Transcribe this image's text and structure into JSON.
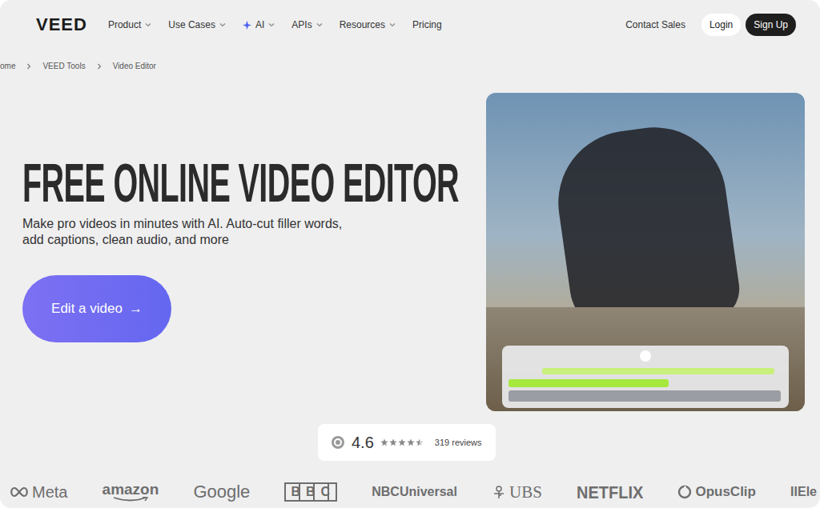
{
  "logo": "VEED",
  "nav": {
    "items": [
      {
        "label": "Product",
        "dropdown": true,
        "kind": "plain"
      },
      {
        "label": "Use Cases",
        "dropdown": true,
        "kind": "plain"
      },
      {
        "label": "AI",
        "dropdown": true,
        "kind": "featured"
      },
      {
        "label": "APIs",
        "dropdown": true,
        "kind": "plain"
      },
      {
        "label": "Resources",
        "dropdown": true,
        "kind": "plain"
      },
      {
        "label": "Pricing",
        "dropdown": false,
        "kind": "plain"
      }
    ],
    "contact": "Contact Sales",
    "login": "Login",
    "signup": "Sign Up"
  },
  "breadcrumb": [
    "ome",
    "VEED Tools",
    "Video Editor"
  ],
  "hero": {
    "title": "FREE ONLINE VIDEO EDITOR",
    "subtitle": "Make pro videos in minutes with AI. Auto-cut filler words, add captions, clean audio, and more",
    "cta": "Edit a video",
    "cta_arrow": "→"
  },
  "rating": {
    "score": "4.6",
    "stars": 4.5,
    "reviews": "319 reviews"
  },
  "logos": [
    {
      "label": "Meta",
      "kind": "meta"
    },
    {
      "label": "amazon",
      "kind": "amazon"
    },
    {
      "label": "Google",
      "kind": "google"
    },
    {
      "label": "BBC",
      "kind": "boxed"
    },
    {
      "label": "NBCUniversal",
      "kind": "plain"
    },
    {
      "label": "UBS",
      "kind": "ubs"
    },
    {
      "label": "NETFLIX",
      "kind": "netflix"
    },
    {
      "label": "OpusClip",
      "kind": "opus"
    },
    {
      "label": "IIEle",
      "kind": "plain"
    }
  ]
}
